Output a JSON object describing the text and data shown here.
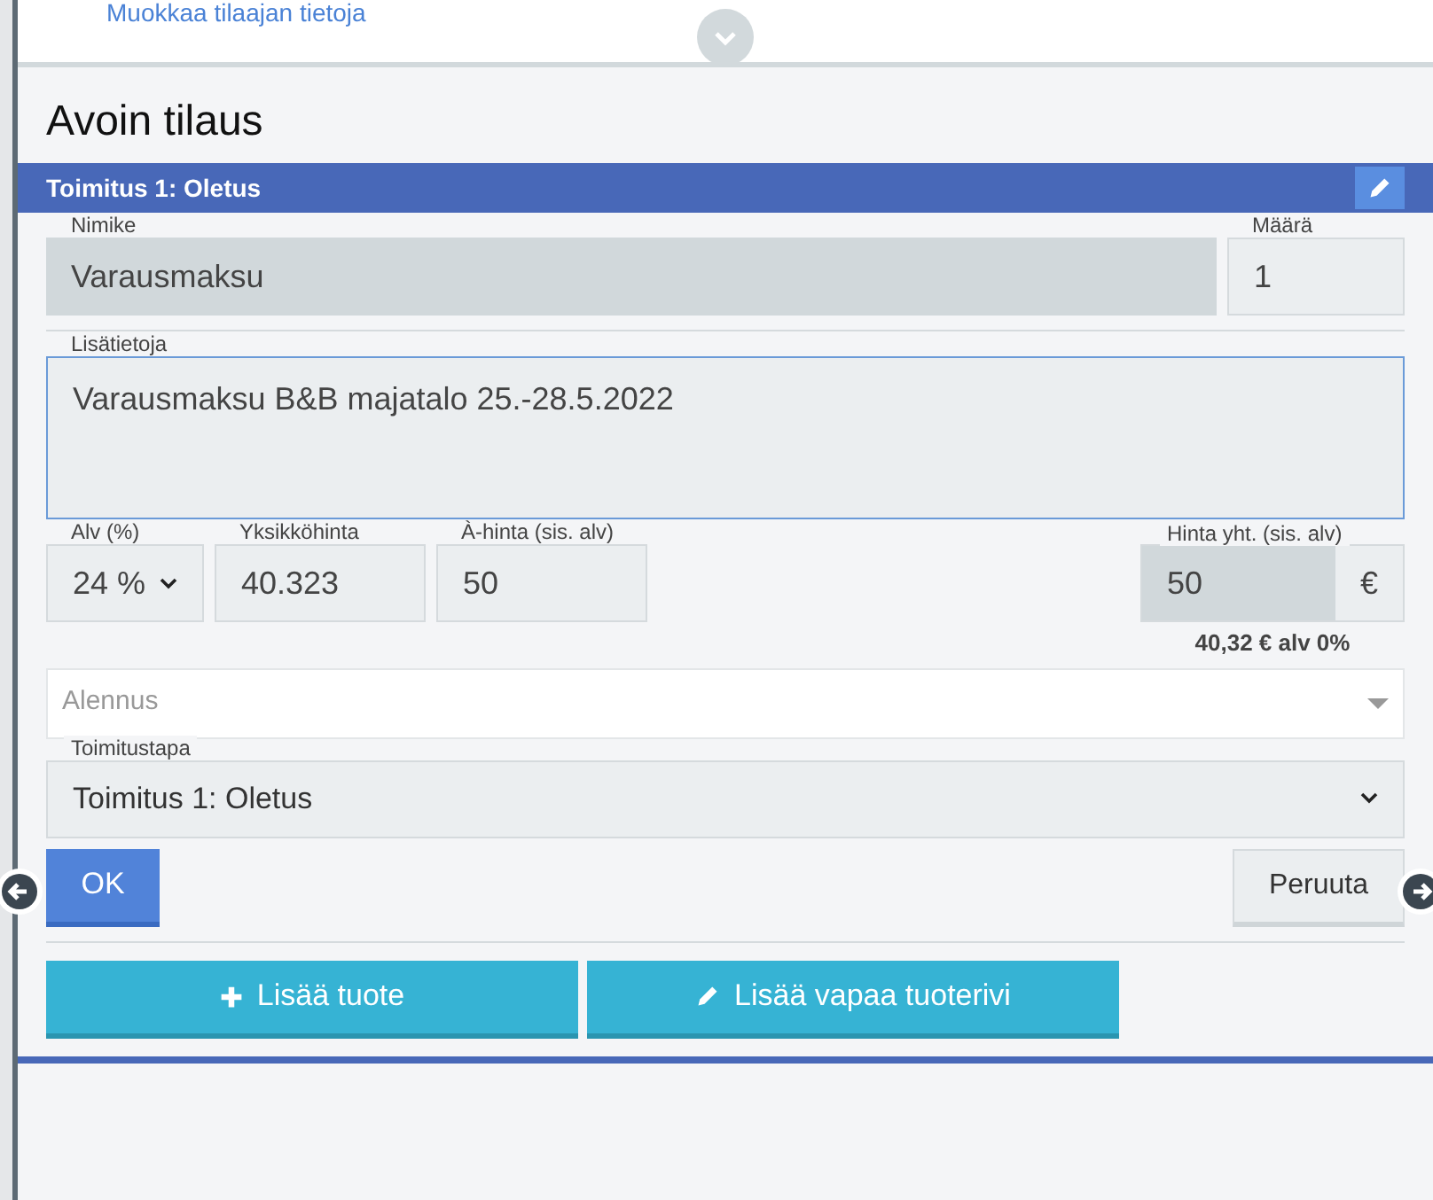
{
  "customer": {
    "edit_link": "Muokkaa tilaajan tietoja"
  },
  "title": "Avoin tilaus",
  "delivery_bar": {
    "title": "Toimitus 1: Oletus"
  },
  "form": {
    "name": {
      "label": "Nimike",
      "value": "Varausmaksu",
      "disabled": true
    },
    "quantity": {
      "label": "Määrä",
      "value": "1"
    },
    "details": {
      "label": "Lisätietoja",
      "value": "Varausmaksu B&B majatalo 25.-28.5.2022"
    },
    "vat": {
      "label": "Alv (%)",
      "value": "24 %"
    },
    "unit_price": {
      "label": "Yksikköhinta",
      "value": "40.323"
    },
    "price_incl": {
      "label": "À-hinta (sis. alv)",
      "value": "50"
    },
    "total": {
      "label": "Hinta yht. (sis. alv)",
      "value": "50",
      "currency": "€",
      "note": "40,32 € alv 0%",
      "disabled": true
    },
    "discount": {
      "placeholder": "Alennus"
    },
    "delivery_method": {
      "label": "Toimitustapa",
      "value": "Toimitus 1: Oletus"
    }
  },
  "buttons": {
    "ok": "OK",
    "cancel": "Peruuta"
  },
  "actions": [
    {
      "kind": "add",
      "label": "Lisää tuote"
    },
    {
      "kind": "edit",
      "label": "Lisää vapaa tuoterivi"
    }
  ]
}
